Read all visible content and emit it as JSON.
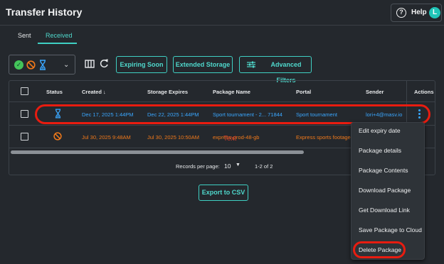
{
  "header": {
    "title": "Transfer History",
    "help_label": "Help",
    "avatar_initial": "L"
  },
  "tabs": [
    {
      "label": "Sent",
      "active": false
    },
    {
      "label": "Received",
      "active": true
    }
  ],
  "toolbar": {
    "status_filter_icons": [
      "check-circle-icon",
      "ban-icon",
      "hourglass-icon"
    ],
    "buttons": {
      "expiring": "Expiring Soon",
      "extended": "Extended Storage",
      "advanced": "Advanced Filters"
    }
  },
  "table": {
    "columns": [
      "Status",
      "Created",
      "Storage Expires",
      "Package Name",
      "Portal",
      "Sender",
      "Actions"
    ],
    "rows": [
      {
        "status_icon": "hourglass-icon",
        "created": "Dec 17, 2025 1:44PM",
        "expires": "Dec 22, 2025 1:44PM",
        "package": "Sport tournament - 2... 71844",
        "portal": "Sport tournament",
        "sender": "lori+4@masv.io"
      },
      {
        "status_icon": "ban-icon",
        "created": "Jul 30, 2025 9:48AM",
        "expires": "Jul 30, 2025 10:50AM",
        "package": "express-prod-48-gb",
        "portal": "Express sports footage",
        "sender": ""
      }
    ],
    "footer": {
      "rpp_label": "Records per page:",
      "rpp_value": "10",
      "range": "1-2 of 2"
    }
  },
  "export_label": "Export to CSV",
  "context_menu": [
    "Edit expiry date",
    "Package details",
    "Package Contents",
    "Download Package",
    "Get Download Link",
    "Save Package to Cloud",
    "Delete Package"
  ],
  "overlay_text": "Text",
  "colors": {
    "accent": "#3fd0c3",
    "link_blue": "#3aa7ff",
    "warn_orange": "#f1791a",
    "highlight_red": "#e81c10",
    "background": "#24282d"
  }
}
